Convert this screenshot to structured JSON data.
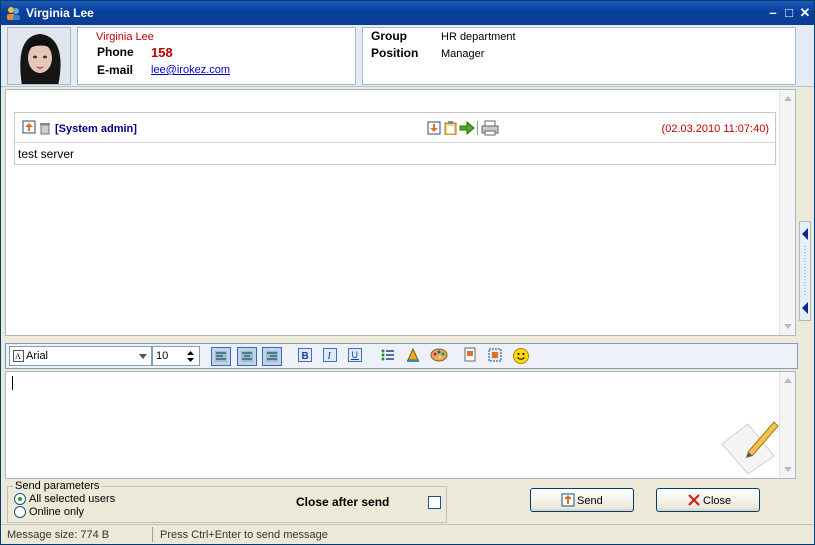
{
  "window": {
    "title": "Virginia Lee",
    "controls": [
      "minimize-icon",
      "maximize-icon",
      "close-icon"
    ]
  },
  "contact": {
    "name": "Virginia Lee",
    "phone_label": "Phone",
    "phone": "158",
    "email_label": "E-mail",
    "email": "lee@irokez.com",
    "group_label": "Group",
    "group": "HR department",
    "position_label": "Position",
    "position": "Manager"
  },
  "message": {
    "sender": "[System admin]",
    "timestamp": "(02.03.2010 11:07:40)",
    "text": "test server"
  },
  "toolbar": {
    "font": "Arial",
    "size": "10",
    "buttons": [
      "align-left-icon",
      "align-center-icon",
      "align-right-icon",
      "bold-icon",
      "italic-icon",
      "underline-icon",
      "bullet-list-icon",
      "text-color-icon",
      "palette-icon",
      "insert-file-icon",
      "screenshot-icon",
      "smiley-icon"
    ]
  },
  "send_params": {
    "title": "Send parameters",
    "options": [
      "All selected users",
      "Online only"
    ],
    "selected": "All selected users",
    "close_after_send": "Close after send",
    "close_after_send_checked": false
  },
  "buttons": {
    "send": "Send",
    "close": "Close"
  },
  "status": {
    "message_size": "Message size: 774 B",
    "hint": "Press Ctrl+Enter to send message"
  },
  "colors": {
    "titlebar": "#0b3d92",
    "accent_red": "#c00000",
    "link": "#0000cc",
    "sender": "#000080"
  }
}
